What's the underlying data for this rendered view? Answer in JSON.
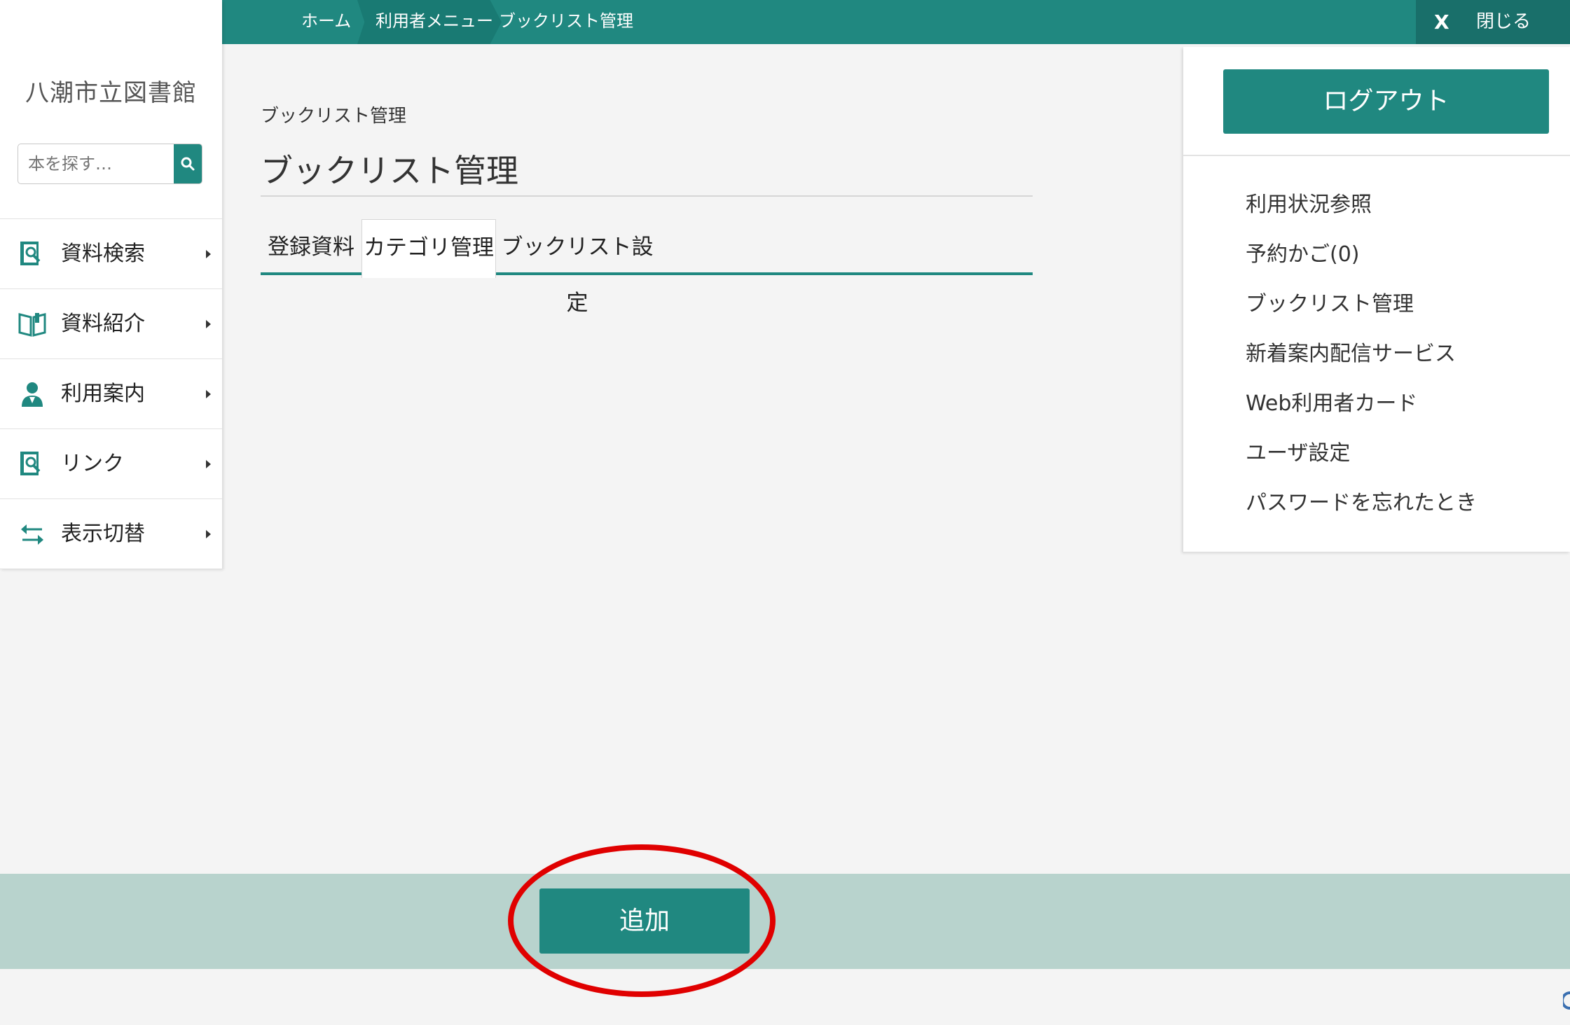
{
  "topbar": {
    "breadcrumbs": [
      "ホーム",
      "利用者メニュー",
      "ブックリスト管理"
    ],
    "close_x": "X",
    "close_label": "閉じる"
  },
  "sidebar": {
    "library_name": "八潮市立図書館",
    "search_placeholder": "本を探す…",
    "items": [
      {
        "label": "資料検索",
        "icon": "book-search-icon"
      },
      {
        "label": "資料紹介",
        "icon": "open-book-icon"
      },
      {
        "label": "利用案内",
        "icon": "person-icon"
      },
      {
        "label": "リンク",
        "icon": "book-search-icon"
      },
      {
        "label": "表示切替",
        "icon": "swap-arrows-icon"
      }
    ]
  },
  "main": {
    "small_breadcrumb": "ブックリスト管理",
    "title": "ブックリスト管理",
    "tabs": [
      "登録資料",
      "カテゴリ管理",
      "ブックリスト設定"
    ],
    "active_tab": "カテゴリ管理"
  },
  "right_panel": {
    "logout_label": "ログアウト",
    "links": [
      "利用状況参照",
      "予約かご(0)",
      "ブックリスト管理",
      "新着案内配信サービス",
      "Web利用者カード",
      "ユーザ設定",
      "パスワードを忘れたとき"
    ]
  },
  "bottom": {
    "add_label": "追加"
  },
  "colors": {
    "brand": "#208880",
    "bottom_bar": "#b8d3cd",
    "highlight": "#e00000"
  }
}
